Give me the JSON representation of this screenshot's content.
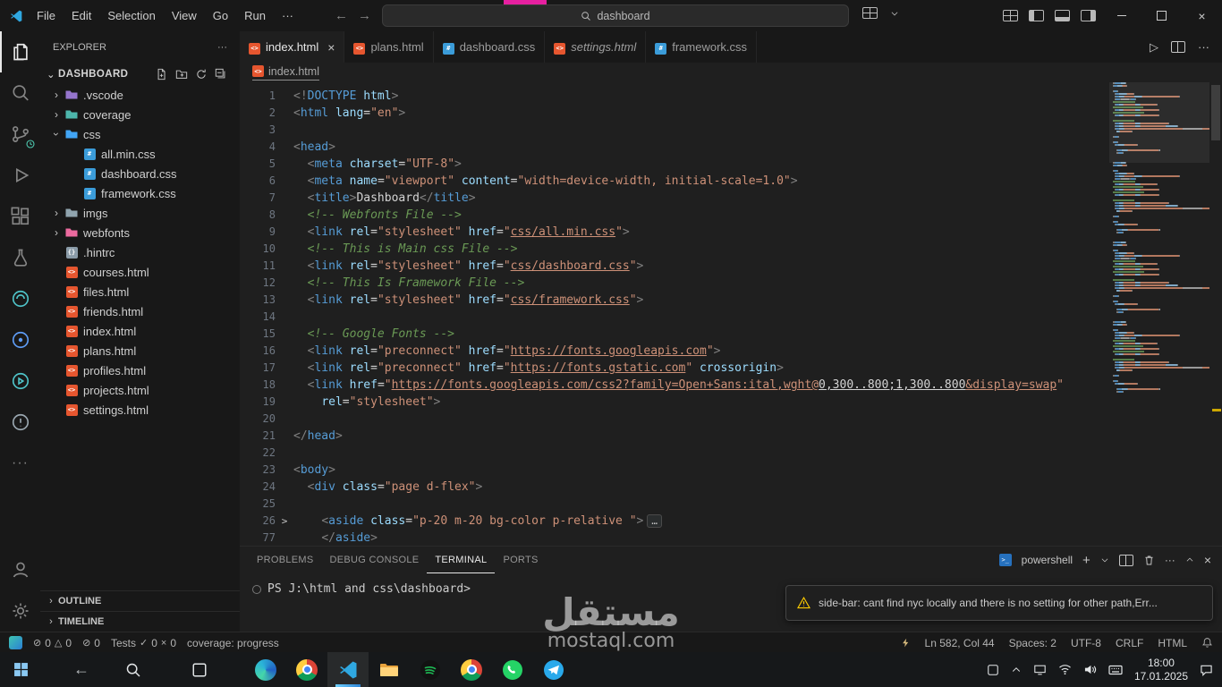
{
  "title_bar": {
    "menu": [
      "File",
      "Edit",
      "Selection",
      "View",
      "Go",
      "Run"
    ],
    "overflow": "···",
    "search_value": "dashboard"
  },
  "explorer": {
    "title": "EXPLORER",
    "section": "DASHBOARD",
    "bottom": [
      "OUTLINE",
      "TIMELINE"
    ],
    "tree": [
      {
        "type": "folder",
        "name": ".vscode",
        "depth": 1,
        "color": "#9575cd"
      },
      {
        "type": "folder",
        "name": "coverage",
        "depth": 1,
        "color": "#4db6ac"
      },
      {
        "type": "folder",
        "name": "css",
        "depth": 1,
        "color": "#42a5f5",
        "expanded": true
      },
      {
        "type": "file",
        "kind": "css",
        "name": "all.min.css",
        "depth": 2
      },
      {
        "type": "file",
        "kind": "css",
        "name": "dashboard.css",
        "depth": 2
      },
      {
        "type": "file",
        "kind": "css",
        "name": "framework.css",
        "depth": 2
      },
      {
        "type": "folder",
        "name": "imgs",
        "depth": 1,
        "color": "#90a4ae"
      },
      {
        "type": "folder",
        "name": "webfonts",
        "depth": 1,
        "color": "#ec6a9f"
      },
      {
        "type": "file",
        "kind": "config",
        "name": ".hintrc",
        "depth": 1
      },
      {
        "type": "file",
        "kind": "html",
        "name": "courses.html",
        "depth": 1
      },
      {
        "type": "file",
        "kind": "html",
        "name": "files.html",
        "depth": 1
      },
      {
        "type": "file",
        "kind": "html",
        "name": "friends.html",
        "depth": 1
      },
      {
        "type": "file",
        "kind": "html",
        "name": "index.html",
        "depth": 1
      },
      {
        "type": "file",
        "kind": "html",
        "name": "plans.html",
        "depth": 1
      },
      {
        "type": "file",
        "kind": "html",
        "name": "profiles.html",
        "depth": 1
      },
      {
        "type": "file",
        "kind": "html",
        "name": "projects.html",
        "depth": 1
      },
      {
        "type": "file",
        "kind": "html",
        "name": "settings.html",
        "depth": 1
      }
    ]
  },
  "editor": {
    "tabs": [
      {
        "name": "index.html",
        "kind": "html",
        "active": true
      },
      {
        "name": "plans.html",
        "kind": "html"
      },
      {
        "name": "dashboard.css",
        "kind": "css"
      },
      {
        "name": "settings.html",
        "kind": "html",
        "italic": true
      },
      {
        "name": "framework.css",
        "kind": "css"
      }
    ],
    "breadcrumb": "index.html",
    "lines": [
      {
        "n": 1,
        "t": [
          [
            "p",
            "<!"
          ],
          [
            "t",
            "DOCTYPE"
          ],
          [
            "a",
            " html"
          ],
          [
            "p",
            ">"
          ]
        ]
      },
      {
        "n": 2,
        "t": [
          [
            "p",
            "<"
          ],
          [
            "t",
            "html"
          ],
          [
            "a",
            " lang"
          ],
          [
            "o",
            "="
          ],
          [
            "s",
            "\"en\""
          ],
          [
            "p",
            ">"
          ]
        ]
      },
      {
        "n": 3,
        "t": []
      },
      {
        "n": 4,
        "t": [
          [
            "p",
            "<"
          ],
          [
            "t",
            "head"
          ],
          [
            "p",
            ">"
          ]
        ]
      },
      {
        "n": 5,
        "t": [
          [
            "x",
            "  "
          ],
          [
            "p",
            "<"
          ],
          [
            "t",
            "meta"
          ],
          [
            "a",
            " charset"
          ],
          [
            "o",
            "="
          ],
          [
            "s",
            "\"UTF-8\""
          ],
          [
            "p",
            ">"
          ]
        ]
      },
      {
        "n": 6,
        "t": [
          [
            "x",
            "  "
          ],
          [
            "p",
            "<"
          ],
          [
            "t",
            "meta"
          ],
          [
            "a",
            " name"
          ],
          [
            "o",
            "="
          ],
          [
            "s",
            "\"viewport\""
          ],
          [
            "a",
            " content"
          ],
          [
            "o",
            "="
          ],
          [
            "s",
            "\"width=device-width, initial-scale=1.0\""
          ],
          [
            "p",
            ">"
          ]
        ]
      },
      {
        "n": 7,
        "t": [
          [
            "x",
            "  "
          ],
          [
            "p",
            "<"
          ],
          [
            "t",
            "title"
          ],
          [
            "p",
            ">"
          ],
          [
            "x",
            "Dashboard"
          ],
          [
            "p",
            "</"
          ],
          [
            "t",
            "title"
          ],
          [
            "p",
            ">"
          ]
        ]
      },
      {
        "n": 8,
        "t": [
          [
            "c",
            "  <!-- Webfonts File -->"
          ]
        ]
      },
      {
        "n": 9,
        "t": [
          [
            "x",
            "  "
          ],
          [
            "p",
            "<"
          ],
          [
            "t",
            "link"
          ],
          [
            "a",
            " rel"
          ],
          [
            "o",
            "="
          ],
          [
            "s",
            "\"stylesheet\""
          ],
          [
            "a",
            " href"
          ],
          [
            "o",
            "="
          ],
          [
            "s",
            "\""
          ],
          [
            "u",
            "css/all.min.css"
          ],
          [
            "s",
            "\""
          ],
          [
            "p",
            ">"
          ]
        ]
      },
      {
        "n": 10,
        "t": [
          [
            "c",
            "  <!-- This is Main css File -->"
          ]
        ]
      },
      {
        "n": 11,
        "t": [
          [
            "x",
            "  "
          ],
          [
            "p",
            "<"
          ],
          [
            "t",
            "link"
          ],
          [
            "a",
            " rel"
          ],
          [
            "o",
            "="
          ],
          [
            "s",
            "\"stylesheet\""
          ],
          [
            "a",
            " href"
          ],
          [
            "o",
            "="
          ],
          [
            "s",
            "\""
          ],
          [
            "u",
            "css/dashboard.css"
          ],
          [
            "s",
            "\""
          ],
          [
            "p",
            ">"
          ]
        ]
      },
      {
        "n": 12,
        "t": [
          [
            "c",
            "  <!-- This Is Framework File -->"
          ]
        ]
      },
      {
        "n": 13,
        "t": [
          [
            "x",
            "  "
          ],
          [
            "p",
            "<"
          ],
          [
            "t",
            "link"
          ],
          [
            "a",
            " rel"
          ],
          [
            "o",
            "="
          ],
          [
            "s",
            "\"stylesheet\""
          ],
          [
            "a",
            " href"
          ],
          [
            "o",
            "="
          ],
          [
            "s",
            "\""
          ],
          [
            "u",
            "css/framework.css"
          ],
          [
            "s",
            "\""
          ],
          [
            "p",
            ">"
          ]
        ]
      },
      {
        "n": 14,
        "t": []
      },
      {
        "n": 15,
        "t": [
          [
            "c",
            "  <!-- Google Fonts -->"
          ]
        ]
      },
      {
        "n": 16,
        "t": [
          [
            "x",
            "  "
          ],
          [
            "p",
            "<"
          ],
          [
            "t",
            "link"
          ],
          [
            "a",
            " rel"
          ],
          [
            "o",
            "="
          ],
          [
            "s",
            "\"preconnect\""
          ],
          [
            "a",
            " href"
          ],
          [
            "o",
            "="
          ],
          [
            "s",
            "\""
          ],
          [
            "u",
            "https://fonts.googleapis.com"
          ],
          [
            "s",
            "\""
          ],
          [
            "p",
            ">"
          ]
        ]
      },
      {
        "n": 17,
        "t": [
          [
            "x",
            "  "
          ],
          [
            "p",
            "<"
          ],
          [
            "t",
            "link"
          ],
          [
            "a",
            " rel"
          ],
          [
            "o",
            "="
          ],
          [
            "s",
            "\"preconnect\""
          ],
          [
            "a",
            " href"
          ],
          [
            "o",
            "="
          ],
          [
            "s",
            "\""
          ],
          [
            "u",
            "https://fonts.gstatic.com"
          ],
          [
            "s",
            "\""
          ],
          [
            "a",
            " crossorigin"
          ],
          [
            "p",
            ">"
          ]
        ]
      },
      {
        "n": 18,
        "t": [
          [
            "x",
            "  "
          ],
          [
            "p",
            "<"
          ],
          [
            "t",
            "link"
          ],
          [
            "a",
            " href"
          ],
          [
            "o",
            "="
          ],
          [
            "s",
            "\""
          ],
          [
            "u",
            "https://fonts.googleapis.com/css2?family=Open+Sans:ital,wght@"
          ],
          [
            "un",
            "0,300..800;1,300..800"
          ],
          [
            "u",
            "&display=swap"
          ],
          [
            "s",
            "\""
          ]
        ]
      },
      {
        "n": 19,
        "t": [
          [
            "x",
            "    "
          ],
          [
            "a",
            "rel"
          ],
          [
            "o",
            "="
          ],
          [
            "s",
            "\"stylesheet\""
          ],
          [
            "p",
            ">"
          ]
        ]
      },
      {
        "n": 20,
        "t": []
      },
      {
        "n": 21,
        "t": [
          [
            "p",
            "</"
          ],
          [
            "t",
            "head"
          ],
          [
            "p",
            ">"
          ]
        ]
      },
      {
        "n": 22,
        "t": []
      },
      {
        "n": 23,
        "t": [
          [
            "p",
            "<"
          ],
          [
            "t",
            "body"
          ],
          [
            "p",
            ">"
          ]
        ]
      },
      {
        "n": 24,
        "t": [
          [
            "x",
            "  "
          ],
          [
            "p",
            "<"
          ],
          [
            "t",
            "div"
          ],
          [
            "a",
            " class"
          ],
          [
            "o",
            "="
          ],
          [
            "s",
            "\"page d-flex\""
          ],
          [
            "p",
            ">"
          ]
        ]
      },
      {
        "n": 25,
        "t": []
      },
      {
        "n": 26,
        "fold": true,
        "t": [
          [
            "x",
            "    "
          ],
          [
            "p",
            "<"
          ],
          [
            "t",
            "aside"
          ],
          [
            "a",
            " class"
          ],
          [
            "o",
            "="
          ],
          [
            "s",
            "\"p-20 m-20 bg-color p-relative \""
          ],
          [
            "p",
            ">"
          ],
          [
            "e",
            "…"
          ]
        ]
      },
      {
        "n": 77,
        "t": [
          [
            "x",
            "    "
          ],
          [
            "p",
            "</"
          ],
          [
            "t",
            "aside"
          ],
          [
            "p",
            ">"
          ]
        ]
      }
    ]
  },
  "panel": {
    "tabs": [
      "PROBLEMS",
      "DEBUG CONSOLE",
      "TERMINAL",
      "PORTS"
    ],
    "active_index": 2,
    "shell": "powershell",
    "prompt": "PS J:\\html and css\\dashboard>"
  },
  "notification": {
    "message": "side-bar: cant find nyc locally and there is no setting for other path,Err..."
  },
  "status": {
    "errors": "0",
    "warnings": "0",
    "ports": "0",
    "tests_label": "Tests",
    "tests_pass": "0",
    "tests_fail": "0",
    "coverage": "coverage: progress",
    "cursor": "Ln 582, Col 44",
    "spaces": "Spaces: 2",
    "encoding": "UTF-8",
    "eol": "CRLF",
    "language": "HTML"
  },
  "taskbar": {
    "time": "18:00",
    "date": "17.01.2025"
  },
  "watermark": {
    "arabic": "مستقل",
    "latin": "mostaql.com"
  }
}
